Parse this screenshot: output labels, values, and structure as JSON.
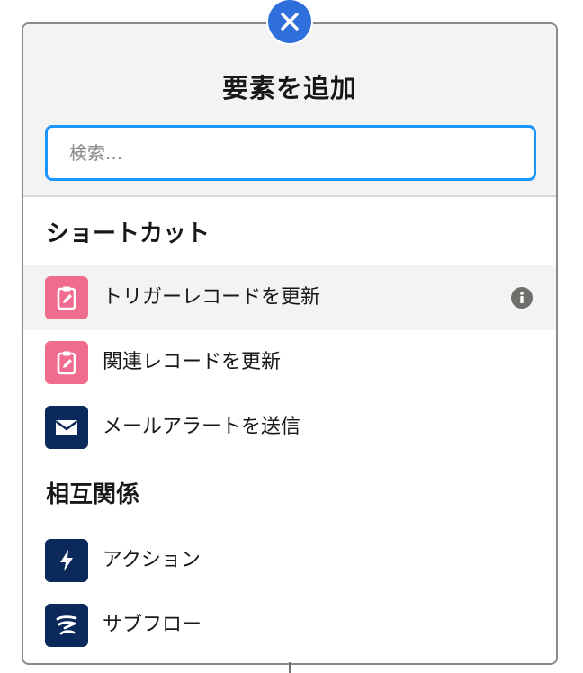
{
  "panel": {
    "title": "要素を追加",
    "search": {
      "placeholder": "検索...",
      "value": ""
    }
  },
  "sections": [
    {
      "heading": "ショートカット",
      "items": [
        {
          "label": "トリガーレコードを更新",
          "icon": "record-update-icon",
          "color": "#f06c8e",
          "selected": true
        },
        {
          "label": "関連レコードを更新",
          "icon": "record-update-icon",
          "color": "#f06c8e",
          "selected": false
        },
        {
          "label": "メールアラートを送信",
          "icon": "email-icon",
          "color": "#0b2a5b",
          "selected": false
        }
      ]
    },
    {
      "heading": "相互関係",
      "items": [
        {
          "label": "アクション",
          "icon": "lightning-bolt-icon",
          "color": "#0b2a5b",
          "selected": false
        },
        {
          "label": "サブフロー",
          "icon": "subflow-icon",
          "color": "#0b2a5b",
          "selected": false
        }
      ]
    }
  ],
  "colors": {
    "accent": "#1b96ff",
    "close_button": "#2f6fdb",
    "header_bg": "#f3f3f3",
    "pink_icon": "#f06c8e",
    "navy_icon": "#0b2a5b"
  }
}
